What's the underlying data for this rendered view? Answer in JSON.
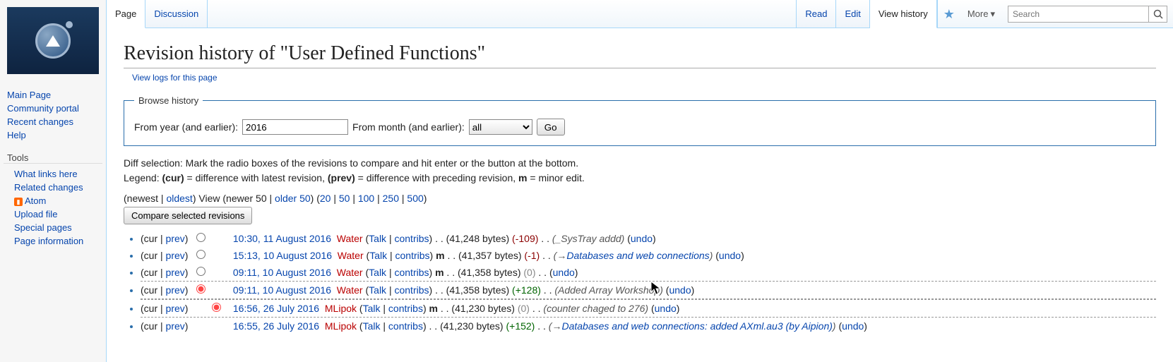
{
  "tabs": {
    "page": "Page",
    "discussion": "Discussion",
    "read": "Read",
    "edit": "Edit",
    "view_history": "View history",
    "more": "More"
  },
  "search": {
    "placeholder": "Search"
  },
  "sidebar": {
    "nav": [
      "Main Page",
      "Community portal",
      "Recent changes",
      "Help"
    ],
    "tools_head": "Tools",
    "tools": [
      "What links here",
      "Related changes",
      "Atom",
      "Upload file",
      "Special pages",
      "Page information"
    ]
  },
  "page": {
    "title": "Revision history of \"User Defined Functions\"",
    "logs_link": "View logs for this page"
  },
  "browse": {
    "legend": "Browse history",
    "from_year": "From year (and earlier):",
    "year_val": "2016",
    "from_month": "From month (and earlier):",
    "month_sel": "all",
    "go": "Go"
  },
  "diff": {
    "sel_text": "Diff selection: Mark the radio boxes of the revisions to compare and hit enter or the button at the bottom.",
    "legend_pre": "Legend: ",
    "cur_b": "(cur)",
    "cur_t": " = difference with latest revision, ",
    "prev_b": "(prev)",
    "prev_t": " = difference with preceding revision, ",
    "m_b": "m",
    "m_t": " = minor edit."
  },
  "pager": {
    "newest": "newest",
    "oldest": "oldest",
    "view": "View",
    "newer50": "newer 50",
    "older50": "older 50",
    "n20": "20",
    "n50": "50",
    "n100": "100",
    "n250": "250",
    "n500": "500"
  },
  "compare": "Compare selected revisions",
  "labels": {
    "cur": "cur",
    "prev": "prev",
    "talk": "Talk",
    "contribs": "contribs",
    "undo": "undo"
  },
  "revisions": [
    {
      "ts": "10:30, 11 August 2016",
      "user": "Water",
      "uclass": "user-water",
      "minor": false,
      "bytes": "41,248 bytes",
      "delta": "-109",
      "dclass": "bytes-neg",
      "summary": "_SysTray addd",
      "arrow": false
    },
    {
      "ts": "15:13, 10 August 2016",
      "user": "Water",
      "uclass": "user-water",
      "minor": true,
      "bytes": "41,357 bytes",
      "delta": "-1",
      "dclass": "bytes-neg",
      "summary": "Databases and web connections",
      "arrow": true
    },
    {
      "ts": "09:11, 10 August 2016",
      "user": "Water",
      "uclass": "user-water",
      "minor": true,
      "bytes": "41,358 bytes",
      "delta": "0",
      "dclass": "bytes-zero",
      "summary": "",
      "arrow": false
    },
    {
      "ts": "09:11, 10 August 2016",
      "user": "Water",
      "uclass": "user-water",
      "minor": false,
      "bytes": "41,358 bytes",
      "delta": "+128",
      "dclass": "bytes-pos",
      "summary": "Added Array Workshop",
      "arrow": false,
      "sel1": true
    },
    {
      "ts": "16:56, 26 July 2016",
      "user": "MLipok",
      "uclass": "user-mlipok",
      "minor": true,
      "bytes": "41,230 bytes",
      "delta": "0",
      "dclass": "bytes-zero",
      "summary": "counter chaged to 276",
      "arrow": false,
      "sel2": true
    },
    {
      "ts": "16:55, 26 July 2016",
      "user": "MLipok",
      "uclass": "user-mlipok",
      "minor": false,
      "bytes": "41,230 bytes",
      "delta": "+152",
      "dclass": "bytes-pos",
      "summary": "Databases and web connections: added AXml.au3 (by Aipion)",
      "arrow": true
    }
  ]
}
